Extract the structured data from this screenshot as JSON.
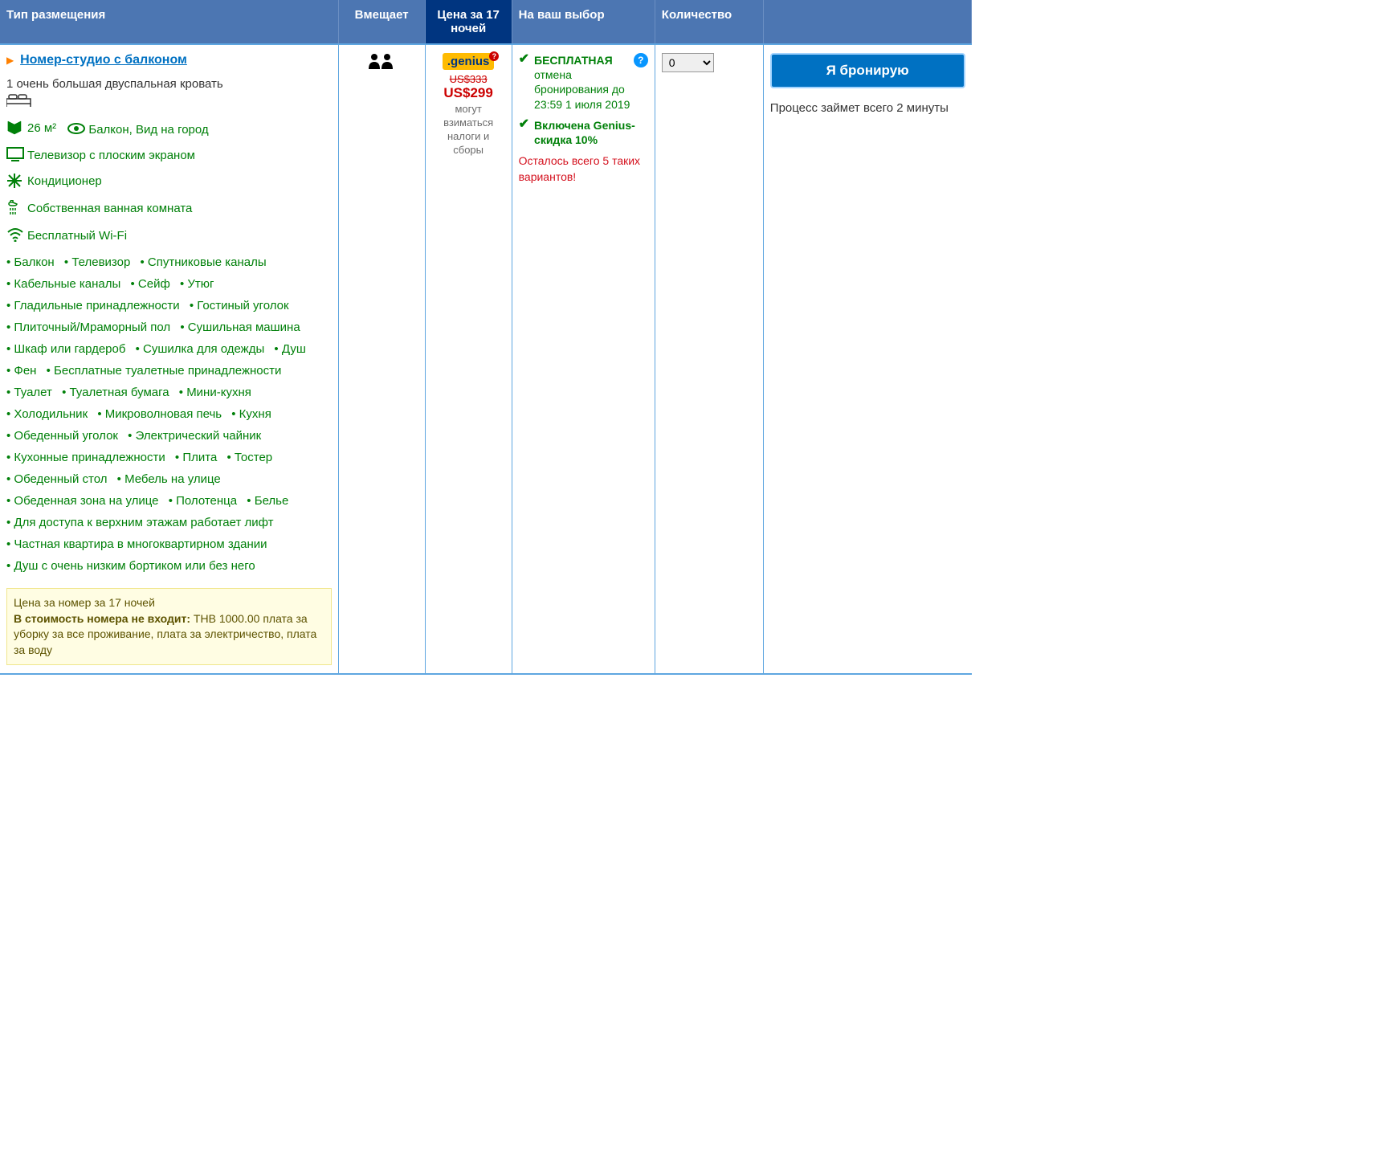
{
  "headers": {
    "type": "Тип размещения",
    "sleeps": "Вмещает",
    "price": "Цена за 17 ночей",
    "choice": "На ваш выбор",
    "qty": "Количество"
  },
  "room": {
    "name": " Номер-студио с балконом",
    "bed": "1 очень большая двуспальная кровать",
    "size": "26 м²",
    "view": "Балкон, Вид на город",
    "tv": "Телевизор с плоским экраном",
    "ac": "Кондиционер",
    "bath": "Собственная ванная комната",
    "wifi": "Бесплатный Wi-Fi",
    "amenities": [
      "Балкон",
      "Телевизор",
      "Спутниковые каналы",
      "Кабельные каналы",
      "Сейф",
      "Утюг",
      "Гладильные принадлежности",
      "Гостиный уголок",
      "Плиточный/Мраморный пол",
      "Сушильная машина",
      "Шкаф или гардероб",
      "Сушилка для одежды",
      "Душ",
      "Фен",
      "Бесплатные туалетные принадлежности",
      "Туалет",
      "Туалетная бумага",
      "Мини-кухня",
      "Холодильник",
      "Микроволновая печь",
      "Кухня",
      "Обеденный уголок",
      "Электрический чайник",
      "Кухонные принадлежности",
      "Плита",
      "Тостер",
      "Обеденный стол",
      "Мебель на улице",
      "Обеденная зона на улице",
      "Полотенца",
      "Белье",
      "Для доступа к верхним этажам работает лифт",
      "Частная квартира в многоквартирном здании",
      "Душ с очень низким бортиком или без него"
    ],
    "price_note_title": "Цена за номер за 17 ночей",
    "price_note_bold": "В стоимость номера не входит:",
    "price_note_rest": " THB 1000.00 плата за уборку за все проживание, плата за электричество, плата за воду"
  },
  "price": {
    "genius": ".genius",
    "old": "US$333",
    "new": "US$299",
    "tax": "могут взиматься налоги и сборы"
  },
  "choice": {
    "free_cancel_bold": "БЕСПЛАТНАЯ",
    "free_cancel_rest": " отмена бронирования до 23:59 1 июля 2019",
    "genius_discount": "Включена Genius-скидка 10%",
    "scarcity": "Осталось всего 5 таких вариантов!"
  },
  "qty": {
    "value": "0"
  },
  "cta": {
    "button": "Я бронирую",
    "note": "Процесс займет всего 2 минуты"
  }
}
